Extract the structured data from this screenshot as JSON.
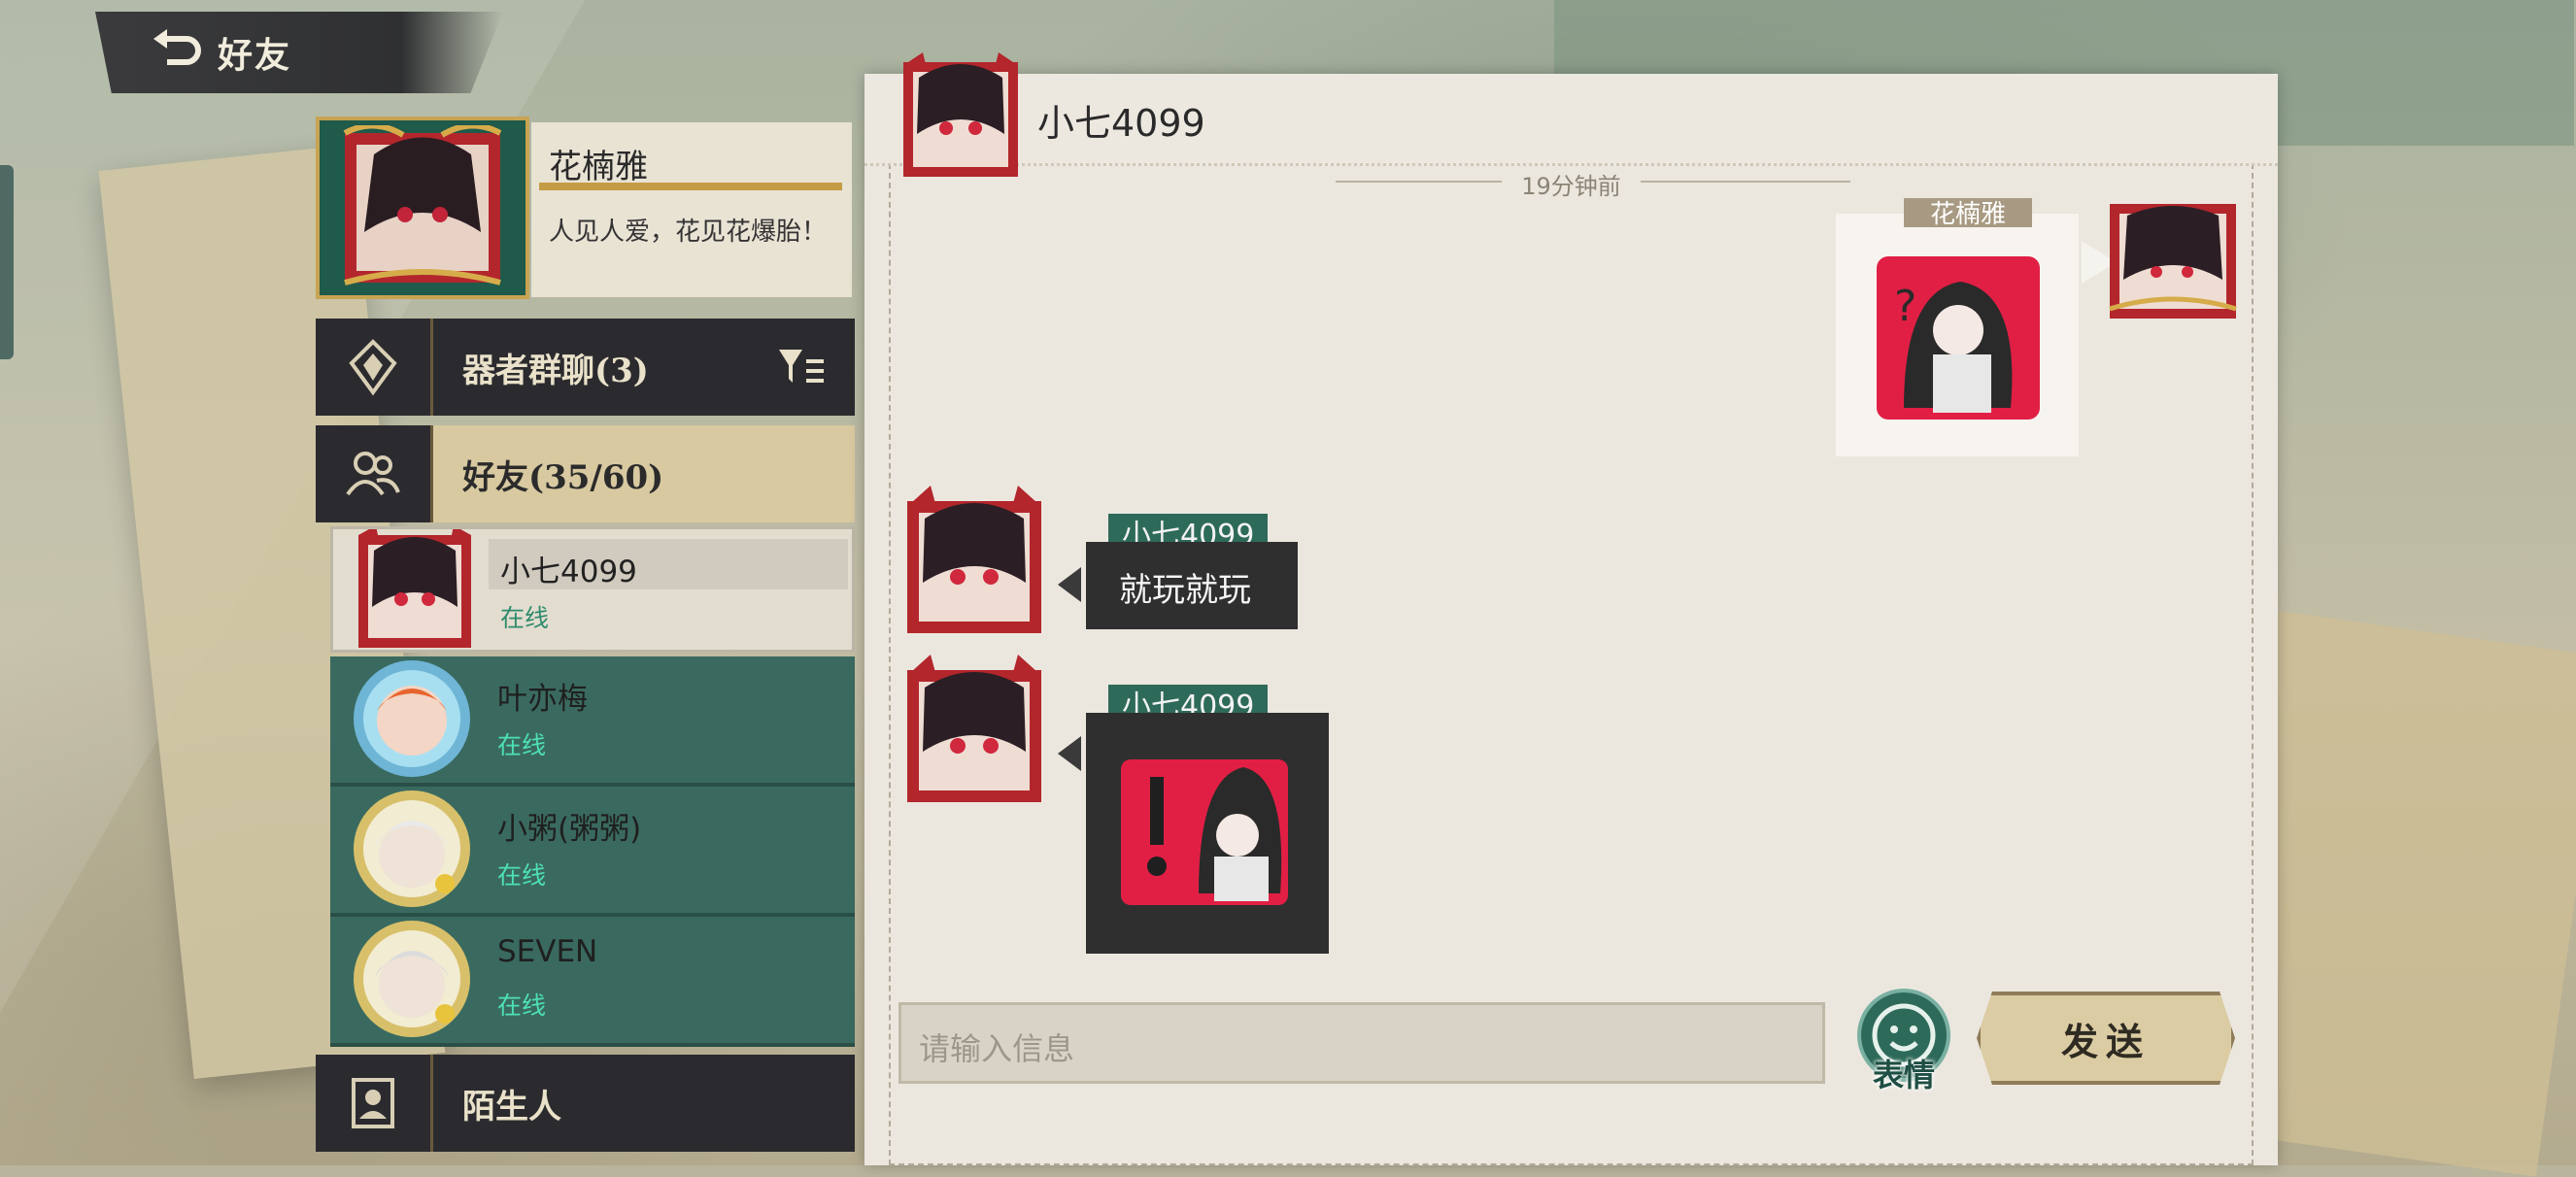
{
  "header": {
    "title": "好友"
  },
  "profile": {
    "name": "花楠雅",
    "signature": "人见人爱，花见花爆胎！"
  },
  "categories": {
    "group_chat": "器者群聊(3)",
    "friends": "好友(35/60)",
    "strangers": "陌生人"
  },
  "friends": [
    {
      "name": "小七4099",
      "status": "在线"
    },
    {
      "name": "叶亦梅",
      "status": "在线"
    },
    {
      "name": "小粥(粥粥)",
      "status": "在线"
    },
    {
      "name": "SEVEN",
      "status": "在线"
    }
  ],
  "chat": {
    "title": "小七4099",
    "time_divider": "19分钟前",
    "my_name": "花楠雅",
    "messages": [
      {
        "sender": "小七4099",
        "text": "就玩就玩"
      },
      {
        "sender": "小七4099",
        "text": ""
      }
    ],
    "input_placeholder": "请输入信息",
    "emoji_label": "表情",
    "send_label": "发送"
  },
  "colors": {
    "accent_teal": "#3a6a5f",
    "online_green": "#4ee0b5",
    "dark_panel": "#2b2b2f",
    "gold": "#c59c45"
  }
}
